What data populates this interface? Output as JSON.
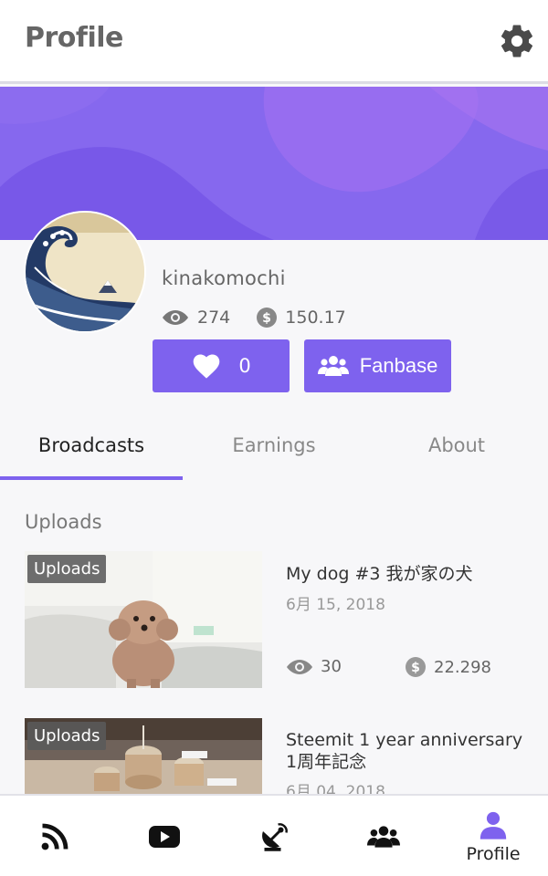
{
  "header": {
    "title": "Profile",
    "settings_icon": "gear-icon"
  },
  "profile": {
    "username": "kinakomochi",
    "views": "274",
    "earnings": "150.17",
    "likes_count": "0",
    "fanbase_label": "Fanbase"
  },
  "tabs": [
    {
      "label": "Broadcasts",
      "active": true
    },
    {
      "label": "Earnings",
      "active": false
    },
    {
      "label": "About",
      "active": false
    }
  ],
  "section": {
    "title": "Uploads"
  },
  "uploads": [
    {
      "badge": "Uploads",
      "title": "My dog #3 我が家の犬",
      "date": "6月 15, 2018",
      "views": "30",
      "earnings": "22.298"
    },
    {
      "badge": "Uploads",
      "title": "Steemit 1 year anniversary 1周年記念",
      "date": "6月 04, 2018"
    }
  ],
  "bottom_nav": [
    {
      "icon": "rss-feed-icon",
      "label": ""
    },
    {
      "icon": "video-play-icon",
      "label": ""
    },
    {
      "icon": "broadcast-dish-icon",
      "label": ""
    },
    {
      "icon": "community-users-icon",
      "label": ""
    },
    {
      "icon": "profile-user-icon",
      "label": "Profile",
      "active": true
    }
  ],
  "colors": {
    "accent": "#7e62ee",
    "banner": "#8668ee",
    "muted_text": "#666666"
  }
}
